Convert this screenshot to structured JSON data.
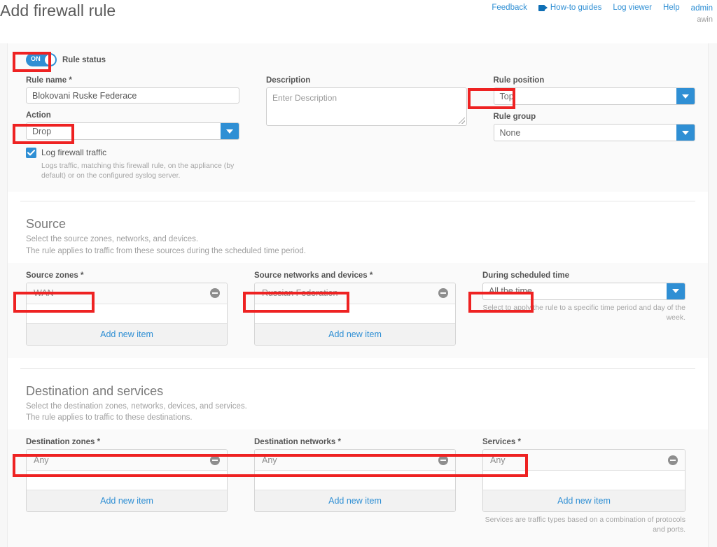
{
  "header": {
    "title": "Add firewall rule",
    "nav": [
      {
        "label": "Feedback",
        "icon": ""
      },
      {
        "label": "How-to guides",
        "icon": "video-camera-icon"
      },
      {
        "label": "Log viewer",
        "icon": ""
      },
      {
        "label": "Help",
        "icon": ""
      }
    ],
    "user": {
      "name": "admin",
      "sub": "awin"
    }
  },
  "rule": {
    "status_toggle": {
      "label": "Rule status",
      "state": "ON"
    },
    "name": {
      "label": "Rule name *",
      "value": "Blokovani Ruske Federace"
    },
    "action": {
      "label": "Action",
      "value": "Drop"
    },
    "log_traffic": {
      "label": "Log firewall traffic",
      "checked": true,
      "hint": "Logs traffic, matching this firewall rule, on the appliance (by default) or on the configured syslog server."
    },
    "description": {
      "label": "Description",
      "placeholder": "Enter Description",
      "value": ""
    },
    "position": {
      "label": "Rule position",
      "value": "Top"
    },
    "group": {
      "label": "Rule group",
      "value": "None"
    }
  },
  "source": {
    "title": "Source",
    "desc_line1": "Select the source zones, networks, and devices.",
    "desc_line2": "The rule applies to traffic from these sources during the scheduled time period.",
    "zones": {
      "label": "Source zones *",
      "items": [
        "WAN"
      ],
      "add_label": "Add new item"
    },
    "networks": {
      "label": "Source networks and devices *",
      "items": [
        "Russian Federation"
      ],
      "add_label": "Add new item"
    },
    "schedule": {
      "label": "During scheduled time",
      "value": "All the time",
      "hint": "Select to apply the rule to a specific time period and day of the week."
    }
  },
  "destination": {
    "title": "Destination and services",
    "desc_line1": "Select the destination zones, networks, devices, and services.",
    "desc_line2": "The rule applies to traffic to these destinations.",
    "zones": {
      "label": "Destination zones *",
      "items": [
        "Any"
      ],
      "add_label": "Add new item"
    },
    "networks": {
      "label": "Destination networks *",
      "items": [
        "Any"
      ],
      "add_label": "Add new item"
    },
    "services": {
      "label": "Services *",
      "items": [
        "Any"
      ],
      "add_label": "Add new item",
      "hint": "Services are traffic types based on a combination of protocols and ports."
    }
  },
  "colors": {
    "accent": "#2f8fd4",
    "link": "#2f8fd4",
    "annotation": "#ee2222",
    "page_bg": "#f7f7f7",
    "card_bg": "#ffffff"
  }
}
